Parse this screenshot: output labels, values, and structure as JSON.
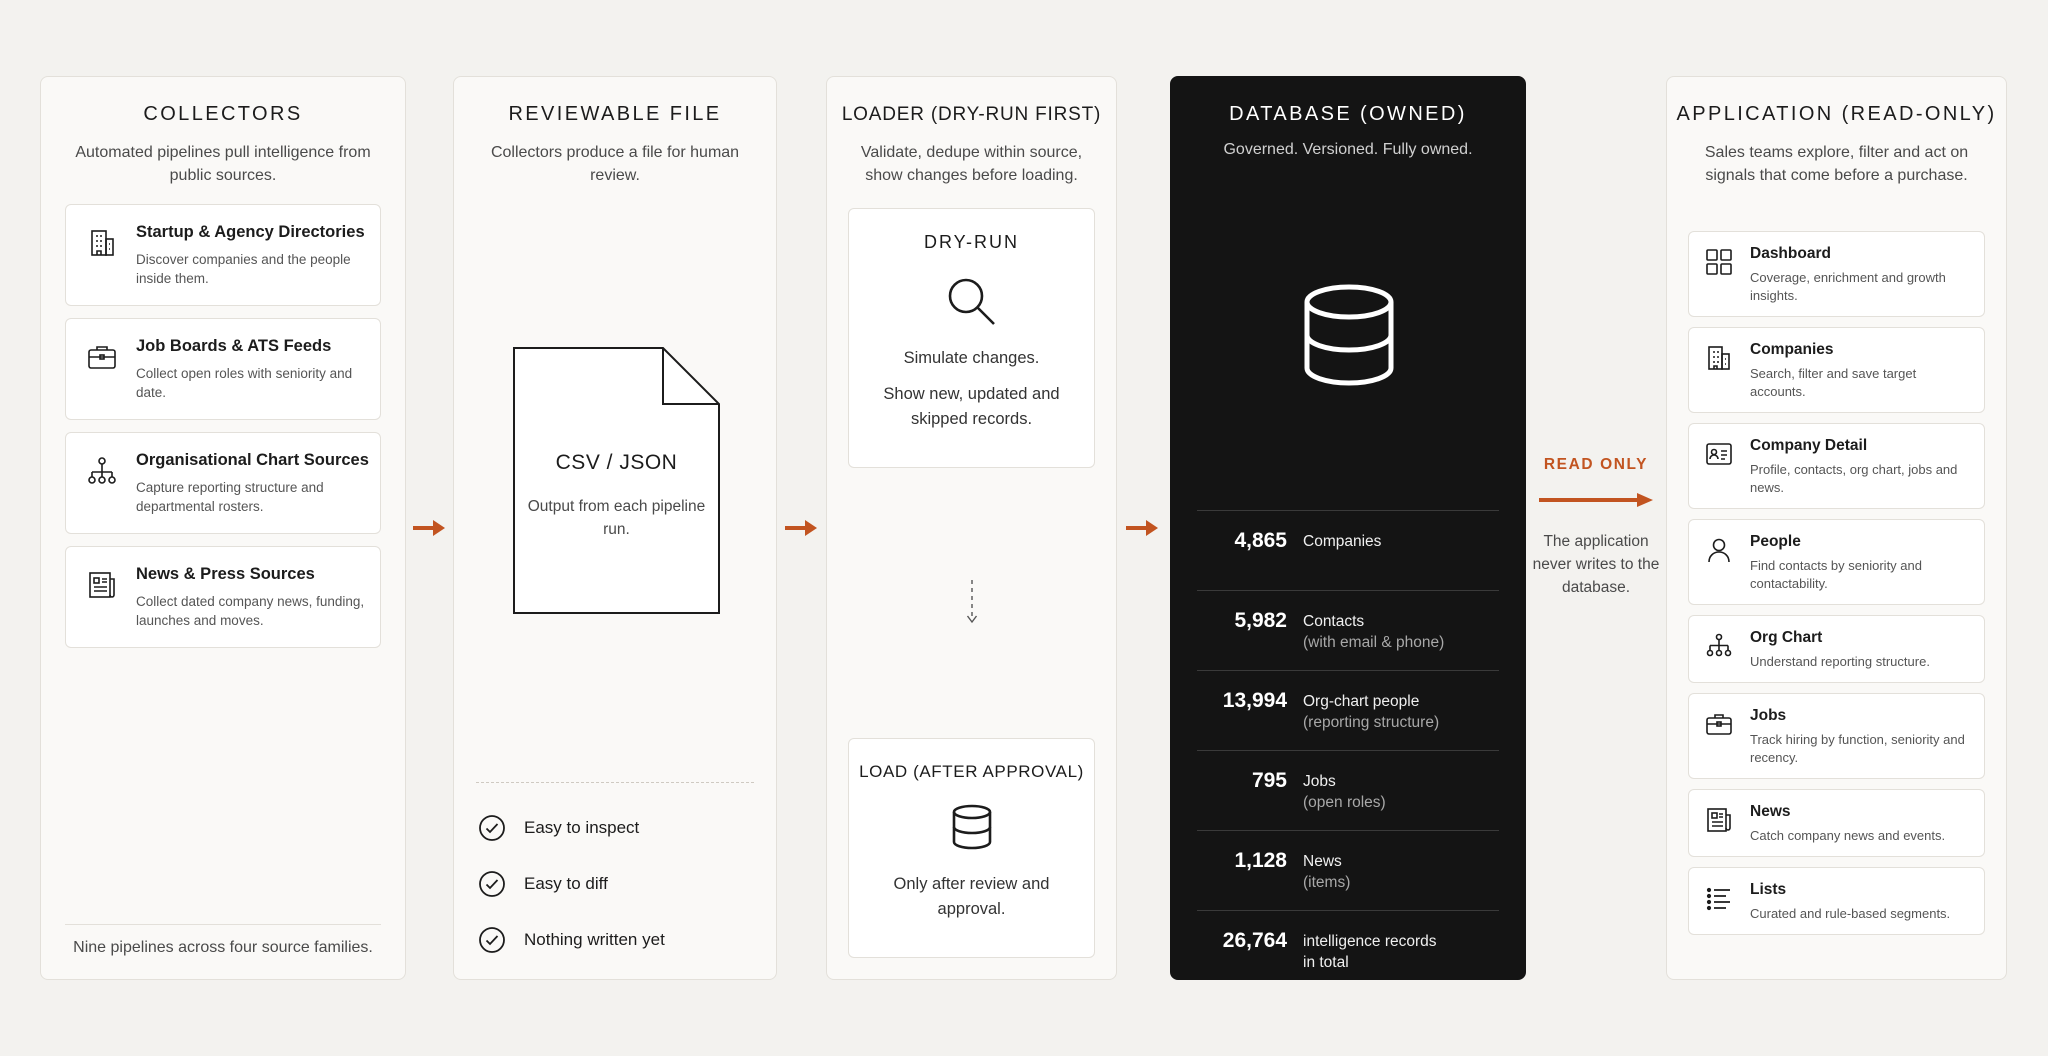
{
  "colors": {
    "accent": "#c25420",
    "database_bg": "#141414",
    "page_bg": "#f3f2ef"
  },
  "collectors": {
    "title": "COLLECTORS",
    "subtitle": "Automated pipelines pull intelligence from public sources.",
    "sources": [
      {
        "icon": "building-icon",
        "title": "Startup & Agency Directories",
        "desc": "Discover companies and the people inside them."
      },
      {
        "icon": "briefcase-icon",
        "title": "Job Boards & ATS Feeds",
        "desc": "Collect open roles with seniority and date."
      },
      {
        "icon": "org-chart-icon",
        "title": "Organisational Chart Sources",
        "desc": "Capture reporting structure and departmental rosters."
      },
      {
        "icon": "newspaper-icon",
        "title": "News & Press Sources",
        "desc": "Collect dated company news, funding, launches and moves."
      }
    ],
    "footer": "Nine pipelines across four source families."
  },
  "reviewable": {
    "title": "REVIEWABLE FILE",
    "subtitle": "Collectors produce a file for human review.",
    "file_title": "CSV / JSON",
    "file_subtitle": "Output from each pipeline run.",
    "checks": [
      "Easy to inspect",
      "Easy to diff",
      "Nothing written yet"
    ]
  },
  "loader": {
    "title": "LOADER (DRY-RUN FIRST)",
    "subtitle": "Validate, dedupe within source, show changes before loading.",
    "dry_run": {
      "title": "DRY-RUN",
      "line1": "Simulate changes.",
      "line2": "Show new, updated and skipped records."
    },
    "load": {
      "title": "LOAD (AFTER APPROVAL)",
      "subtitle": "Only after review and approval."
    }
  },
  "database": {
    "title": "DATABASE (OWNED)",
    "subtitle": "Governed. Versioned. Fully owned.",
    "stats": [
      {
        "value": "4,865",
        "label": "Companies",
        "sub": ""
      },
      {
        "value": "5,982",
        "label": "Contacts",
        "sub": "(with email & phone)"
      },
      {
        "value": "13,994",
        "label": "Org-chart people",
        "sub": "(reporting structure)"
      },
      {
        "value": "795",
        "label": "Jobs",
        "sub": "(open roles)"
      },
      {
        "value": "1,128",
        "label": "News",
        "sub": "(items)"
      },
      {
        "value": "26,764",
        "label": "intelligence records",
        "sub": "in total"
      }
    ]
  },
  "read_only": {
    "title": "READ ONLY",
    "text": "The application never writes to the database."
  },
  "application": {
    "title": "APPLICATION (READ-ONLY)",
    "subtitle": "Sales teams explore, filter and act on signals that come before a purchase.",
    "features": [
      {
        "icon": "dashboard-icon",
        "title": "Dashboard",
        "desc": "Coverage, enrichment and growth insights."
      },
      {
        "icon": "building-icon",
        "title": "Companies",
        "desc": "Search, filter and save target accounts."
      },
      {
        "icon": "id-card-icon",
        "title": "Company Detail",
        "desc": "Profile, contacts, org chart, jobs and news."
      },
      {
        "icon": "person-icon",
        "title": "People",
        "desc": "Find contacts by seniority and contactability."
      },
      {
        "icon": "org-chart-icon",
        "title": "Org Chart",
        "desc": "Understand reporting structure."
      },
      {
        "icon": "briefcase-icon",
        "title": "Jobs",
        "desc": "Track hiring by function, seniority and recency."
      },
      {
        "icon": "newspaper-icon",
        "title": "News",
        "desc": "Catch company news and events."
      },
      {
        "icon": "list-icon",
        "title": "Lists",
        "desc": "Curated and rule-based segments."
      }
    ]
  }
}
